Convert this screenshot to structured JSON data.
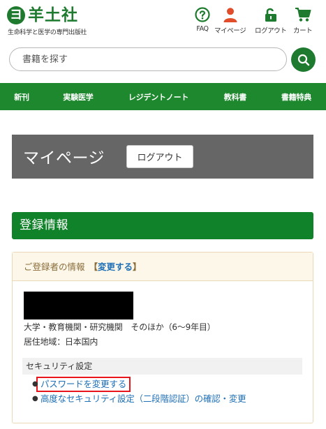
{
  "header": {
    "logo_mark": "ヨ",
    "logo_name": "羊土社",
    "tagline": "生命科学と医学の専門出版社",
    "nav": [
      {
        "label": "FAQ",
        "icon": "question-circle-icon"
      },
      {
        "label": "マイページ",
        "icon": "user-icon"
      },
      {
        "label": "ログアウト",
        "icon": "unlock-icon"
      },
      {
        "label": "カート",
        "icon": "cart-icon"
      }
    ]
  },
  "search": {
    "placeholder": "書籍を探す",
    "button_icon": "search-icon"
  },
  "category_nav": [
    "新刊",
    "実験医学",
    "レジデントノート",
    "教科書",
    "書籍特典"
  ],
  "mypage": {
    "title": "マイページ",
    "logout_label": "ログアウト"
  },
  "registration": {
    "heading": "登録情報",
    "panel_title": "ご登録者の情報",
    "bracket_open": "【",
    "change_label": "変更する",
    "bracket_close": "】",
    "affiliation": "大学・教育機関・研究機関　そのほか（6〜9年目）",
    "region": "居住地域：日本国内",
    "security_heading": "セキュリティ設定",
    "security_links": [
      "パスワードを変更する",
      "高度なセキュリティ設定（二段階認証）の確認・変更"
    ]
  },
  "colors": {
    "brand_green": "#1e7a2e",
    "nav_green": "#1e882e",
    "icon_red": "#e14c2b",
    "banner_gray": "#666666",
    "link_blue": "#1e6fb6",
    "highlight_red": "#e8141c"
  }
}
